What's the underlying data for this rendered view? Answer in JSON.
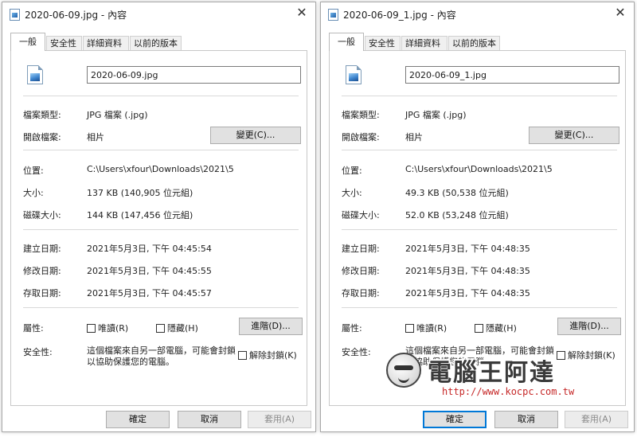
{
  "dialogs": [
    {
      "title": "2020-06-09.jpg - 內容",
      "tabs": [
        "一般",
        "安全性",
        "詳細資料",
        "以前的版本"
      ],
      "file_name": "2020-06-09.jpg",
      "labels": {
        "file_type": "檔案類型:",
        "opens_with": "開啟檔案:",
        "location": "位置:",
        "size": "大小:",
        "size_on_disk": "磁碟大小:",
        "created": "建立日期:",
        "modified": "修改日期:",
        "accessed": "存取日期:",
        "attributes": "屬性:",
        "security": "安全性:"
      },
      "file_type": "JPG 檔案 (.jpg)",
      "opens_with": "相片",
      "change_button": "變更(C)...",
      "location": "C:\\Users\\xfour\\Downloads\\2021\\5",
      "size": "137 KB (140,905 位元組)",
      "size_on_disk": "144 KB (147,456 位元組)",
      "created": "2021年5月3日, 下午 04:45:54",
      "modified": "2021年5月3日, 下午 04:45:55",
      "accessed": "2021年5月3日, 下午 04:45:57",
      "readonly": "唯讀(R)",
      "hidden": "隱藏(H)",
      "advanced_button": "進階(D)...",
      "security_text": "這個檔案來自另一部電腦，可能會封鎖以協助保護您的電腦。",
      "unblock": "解除封鎖(K)",
      "ok": "確定",
      "cancel": "取消",
      "apply": "套用(A)"
    },
    {
      "title": "2020-06-09_1.jpg - 內容",
      "tabs": [
        "一般",
        "安全性",
        "詳細資料",
        "以前的版本"
      ],
      "file_name": "2020-06-09_1.jpg",
      "labels": {
        "file_type": "檔案類型:",
        "opens_with": "開啟檔案:",
        "location": "位置:",
        "size": "大小:",
        "size_on_disk": "磁碟大小:",
        "created": "建立日期:",
        "modified": "修改日期:",
        "accessed": "存取日期:",
        "attributes": "屬性:",
        "security": "安全性:"
      },
      "file_type": "JPG 檔案 (.jpg)",
      "opens_with": "相片",
      "change_button": "變更(C)...",
      "location": "C:\\Users\\xfour\\Downloads\\2021\\5",
      "size": "49.3 KB (50,538 位元組)",
      "size_on_disk": "52.0 KB (53,248 位元組)",
      "created": "2021年5月3日, 下午 04:48:35",
      "modified": "2021年5月3日, 下午 04:48:35",
      "accessed": "2021年5月3日, 下午 04:48:35",
      "readonly": "唯讀(R)",
      "hidden": "隱藏(H)",
      "advanced_button": "進階(D)...",
      "security_text": "這個檔案來自另一部電腦，可能會封鎖以協助保護您的電腦。",
      "unblock": "解除封鎖(K)",
      "ok": "確定",
      "cancel": "取消",
      "apply": "套用(A)"
    }
  ],
  "watermark": {
    "title": "電腦王阿達",
    "url": "http://www.kocpc.com.tw"
  },
  "colors": {
    "focus_blue": "#0078d7",
    "watermark_url": "#c62828"
  }
}
